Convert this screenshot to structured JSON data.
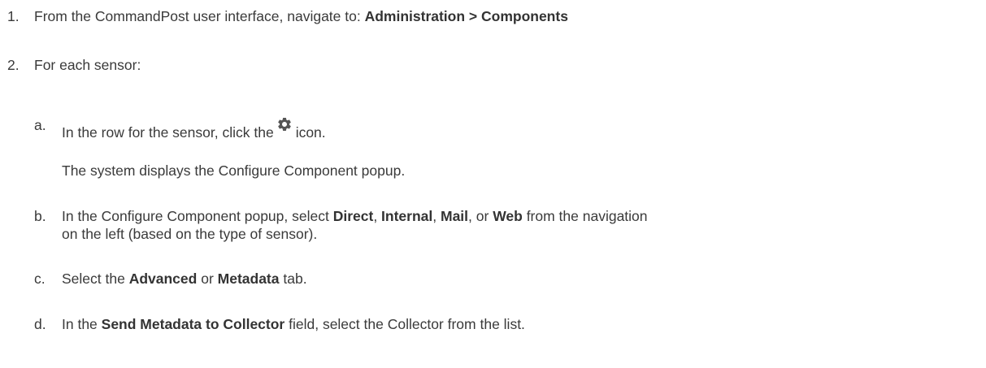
{
  "steps": [
    {
      "number": "1.",
      "text_before": "From the CommandPost user interface, navigate to: ",
      "bold": "Administration > Components"
    },
    {
      "number": "2.",
      "text": "For each sensor:"
    }
  ],
  "substeps": {
    "a": {
      "letter": "a.",
      "text_before": "In the row for the sensor, click the",
      "icon": "gear-icon",
      "text_after": "icon.",
      "result": "The system displays the Configure Component popup."
    },
    "b": {
      "letter": "b.",
      "t1": "In the Configure Component popup, select ",
      "direct": "Direct",
      "c1": ", ",
      "internal": "Internal",
      "c2": ", ",
      "mail": "Mail",
      "c3": ", or ",
      "web": "Web",
      "t2": " from the navigation",
      "line2": "on the left (based on the type of sensor)."
    },
    "c": {
      "letter": "c.",
      "t1": "Select the ",
      "advanced": "Advanced",
      "t2": " or ",
      "metadata": "Metadata",
      "t3": " tab."
    },
    "d": {
      "letter": "d.",
      "t1": "In the ",
      "field": "Send Metadata to Collector",
      "t2": " field, select the Collector from the list."
    }
  },
  "colors": {
    "text": "#3a3a3a",
    "icon": "#555555"
  }
}
